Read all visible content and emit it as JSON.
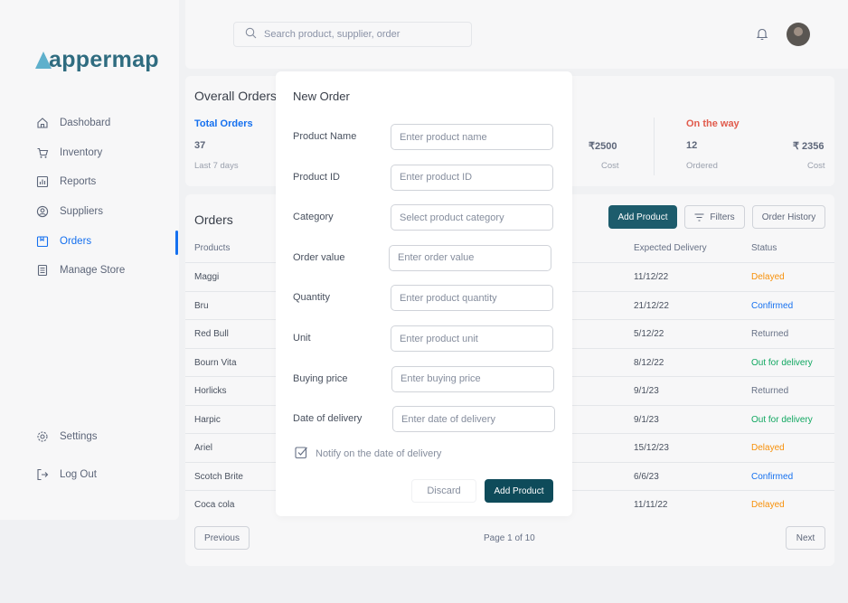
{
  "brand": {
    "name": "appermap"
  },
  "sidebar": {
    "items": [
      {
        "label": "Dashobard",
        "icon": "home-icon"
      },
      {
        "label": "Inventory",
        "icon": "inventory-icon"
      },
      {
        "label": "Reports",
        "icon": "reports-icon"
      },
      {
        "label": "Suppliers",
        "icon": "suppliers-icon"
      },
      {
        "label": "Orders",
        "icon": "orders-icon",
        "active": true
      },
      {
        "label": "Manage Store",
        "icon": "store-icon"
      }
    ],
    "bottom": [
      {
        "label": "Settings",
        "icon": "gear-icon"
      },
      {
        "label": "Log Out",
        "icon": "logout-icon"
      }
    ]
  },
  "header": {
    "search_placeholder": "Search product, supplier, order"
  },
  "overall": {
    "title": "Overall Orders",
    "total": {
      "label": "Total Orders",
      "value": "37",
      "sub": "Last 7 days"
    },
    "partial": {
      "value": "₹2500",
      "sub": "Cost"
    },
    "on_the_way": {
      "label": "On the way",
      "value": "12",
      "sub": "Ordered",
      "cost": "₹ 2356",
      "cost_sub": "Cost"
    }
  },
  "orders": {
    "title": "Orders",
    "add_button": "Add Product",
    "filters_button": "Filters",
    "history_button": "Order History",
    "columns": {
      "product": "Products",
      "expected": "Expected Delivery",
      "status": "Status"
    },
    "rows": [
      {
        "product": "Maggi",
        "expected": "11/12/22",
        "status": "Delayed",
        "kind": "delayed"
      },
      {
        "product": "Bru",
        "expected": "21/12/22",
        "status": "Confirmed",
        "kind": "confirmed"
      },
      {
        "product": "Red Bull",
        "expected": "5/12/22",
        "status": "Returned",
        "kind": "returned"
      },
      {
        "product": "Bourn Vita",
        "expected": "8/12/22",
        "status": "Out for delivery",
        "kind": "out"
      },
      {
        "product": "Horlicks",
        "expected": "9/1/23",
        "status": "Returned",
        "kind": "returned"
      },
      {
        "product": "Harpic",
        "expected": "9/1/23",
        "status": "Out for delivery",
        "kind": "out"
      },
      {
        "product": "Ariel",
        "expected": "15/12/23",
        "status": "Delayed",
        "kind": "delayed"
      },
      {
        "product": "Scotch Brite",
        "expected": "6/6/23",
        "status": "Confirmed",
        "kind": "confirmed"
      },
      {
        "product": "Coca cola",
        "expected": "11/11/22",
        "status": "Delayed",
        "kind": "delayed"
      }
    ],
    "pagination": {
      "previous": "Previous",
      "page": "Page 1 of 10",
      "next": "Next"
    }
  },
  "modal": {
    "title": "New Order",
    "fields": [
      {
        "label": "Product Name",
        "placeholder": "Enter product name"
      },
      {
        "label": "Product ID",
        "placeholder": "Enter product ID"
      },
      {
        "label": "Category",
        "placeholder": "Select product category"
      },
      {
        "label": "Order value",
        "placeholder": "Enter order value"
      },
      {
        "label": "Quantity",
        "placeholder": "Enter product quantity"
      },
      {
        "label": "Unit",
        "placeholder": "Enter product unit"
      },
      {
        "label": "Buying price",
        "placeholder": "Enter buying price"
      },
      {
        "label": "Date of delivery",
        "placeholder": "Enter date of delivery"
      }
    ],
    "notify_label": "Notify on the date of delivery",
    "discard": "Discard",
    "submit": "Add Product"
  },
  "colors": {
    "accent": "#1570ef",
    "primary_button": "#0e4b5a",
    "delayed": "#f79009",
    "out_for_delivery": "#10a760",
    "on_the_way": "#e15b4c"
  }
}
